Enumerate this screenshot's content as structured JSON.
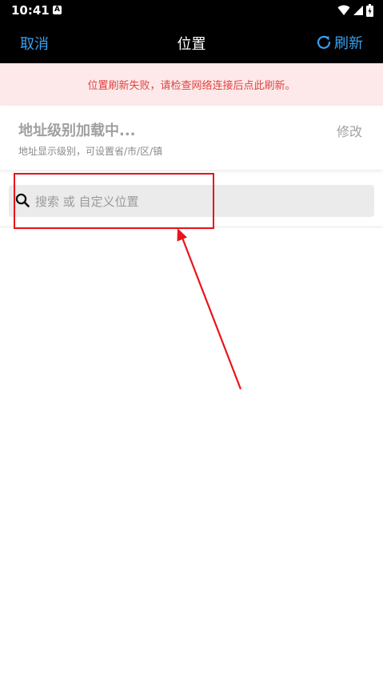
{
  "status_bar": {
    "time": "10:41",
    "notification_badge": "A",
    "icons": [
      "wifi-icon",
      "signal-icon",
      "battery-icon"
    ]
  },
  "nav": {
    "cancel_label": "取消",
    "title": "位置",
    "refresh_label": "刷新",
    "refresh_icon": "refresh-icon",
    "accent_color": "#3aa0f0"
  },
  "error_banner": {
    "message": "位置刷新失败，请检查网络连接后点此刷新。",
    "text_color": "#e04343",
    "background_color": "#fde9e9"
  },
  "address": {
    "title": "地址级别加载中...",
    "edit_label": "修改",
    "subtitle": "地址显示级别，可设置省/市/区/镇"
  },
  "search": {
    "placeholder": "搜索 或 自定义位置",
    "value": "",
    "icon": "search-icon"
  },
  "annotation": {
    "color": "#e8141b"
  }
}
